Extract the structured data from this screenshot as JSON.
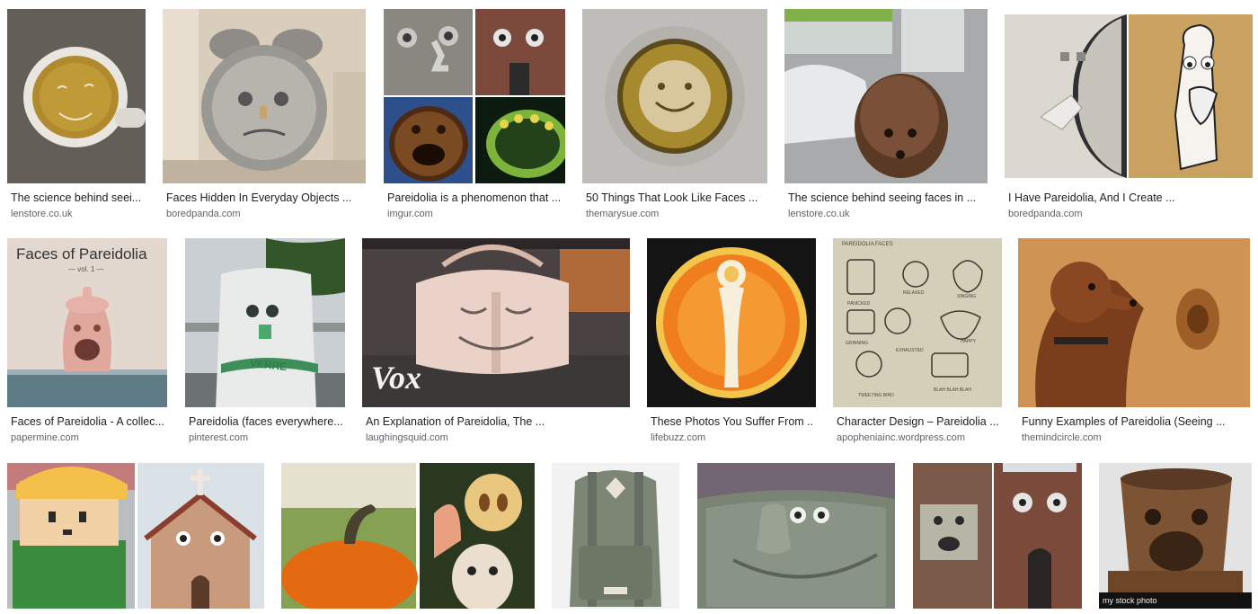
{
  "results": [
    {
      "title": "The science behind seei...",
      "source": "lenstore.co.uk"
    },
    {
      "title": "Faces Hidden In Everyday Objects ...",
      "source": "boredpanda.com"
    },
    {
      "title": "Pareidolia is a phenomenon that ...",
      "source": "imgur.com"
    },
    {
      "title": "50 Things That Look Like Faces ...",
      "source": "themarysue.com"
    },
    {
      "title": "The science behind seeing faces in ...",
      "source": "lenstore.co.uk"
    },
    {
      "title": "I Have Pareidolia, And I Create ...",
      "source": "boredpanda.com"
    },
    {
      "title": "Faces of Pareidolia - A collec...",
      "source": "papermine.com"
    },
    {
      "title": "Pareidolia (faces everywhere...",
      "source": "pinterest.com"
    },
    {
      "title": "An Explanation of Pareidolia, The ...",
      "source": "laughingsquid.com"
    },
    {
      "title": "These Photos You Suffer From ...",
      "source": "lifebuzz.com"
    },
    {
      "title": "Character Design – Pareidolia ...",
      "source": "apopheniainc.wordpress.com"
    },
    {
      "title": "Funny Examples of Pareidolia (Seeing ...",
      "source": "themindcircle.com"
    }
  ],
  "image_text": {
    "book_title": "Faces of Pareidolia",
    "book_subtitle": "— vol. 1 —",
    "bin_label": "VERRE",
    "vox_logo": "Vox",
    "sketch_header": "PAREIDOLIA FACES",
    "sketch_labels": [
      "RELAXED",
      "SINGING",
      "PANICKED",
      "GRINNING",
      "EXHAUSTED",
      "HAPPY",
      "TWEETING BIRD",
      "BLAH BLAH BLAH"
    ],
    "stock_caption": "my stock photo"
  }
}
